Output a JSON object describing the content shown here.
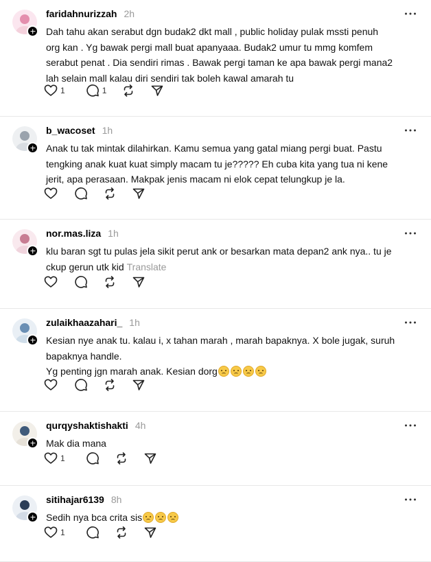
{
  "posts": [
    {
      "username": "faridahnurizzah",
      "time": "2h",
      "lines": [
        "Dah tahu akan serabut dgn budak2 dkt mall , public holiday pulak mssti penuh",
        "org kan . Yg bawak pergi mall buat apanyaaa. Budak2 umur tu mmg komfem",
        "serabut penat . Dia sendiri rimas . Bawak pergi taman ke apa bawak pergi mana2",
        "lah selain mall kalau diri sendiri tak boleh kawal amarah tu"
      ],
      "likes": "1",
      "replies": "1"
    },
    {
      "username": "b_wacoset",
      "time": "1h",
      "lines": [
        "Anak tu tak mintak dilahirkan. Kamu semua yang gatal miang pergi buat. Pastu",
        "tengking anak kuat kuat simply macam tu je????? Eh cuba kita yang tua ni kene",
        "jerit, apa perasaan. Makpak jenis macam ni elok cepat telungkup je la."
      ]
    },
    {
      "username": "nor.mas.liza",
      "time": "1h",
      "lines": [
        "klu baran sgt tu pulas jela sikit perut ank or besarkan mata depan2 ank nya.. tu je",
        "ckup gerun utk kid"
      ],
      "translate": "Translate"
    },
    {
      "username": "zulaikhaazahari_",
      "time": "1h",
      "lines": [
        "Kesian nye anak tu. kalau i, x tahan marah , marah bapaknya. X bole jugak, suruh",
        "bapaknya handle.",
        "Yg penting jgn marah anak. Kesian dorg"
      ],
      "emoji_count": 4
    },
    {
      "username": "qurqyshaktishakti",
      "time": "4h",
      "lines": [
        "Mak dia mana"
      ],
      "likes": "1"
    },
    {
      "username": "sitihajar6139",
      "time": "8h",
      "lines": [
        "Sedih nya bca crita sis"
      ],
      "emoji_count": 3,
      "likes": "1"
    }
  ],
  "icons": {
    "like": "heart-icon",
    "reply": "comment-icon",
    "repost": "repost-icon",
    "share": "send-icon",
    "more": "more-options-icon",
    "follow": "plus-icon"
  },
  "colors": {
    "muted": "#999999",
    "divider": "#e8e8e8",
    "text": "#111111"
  }
}
